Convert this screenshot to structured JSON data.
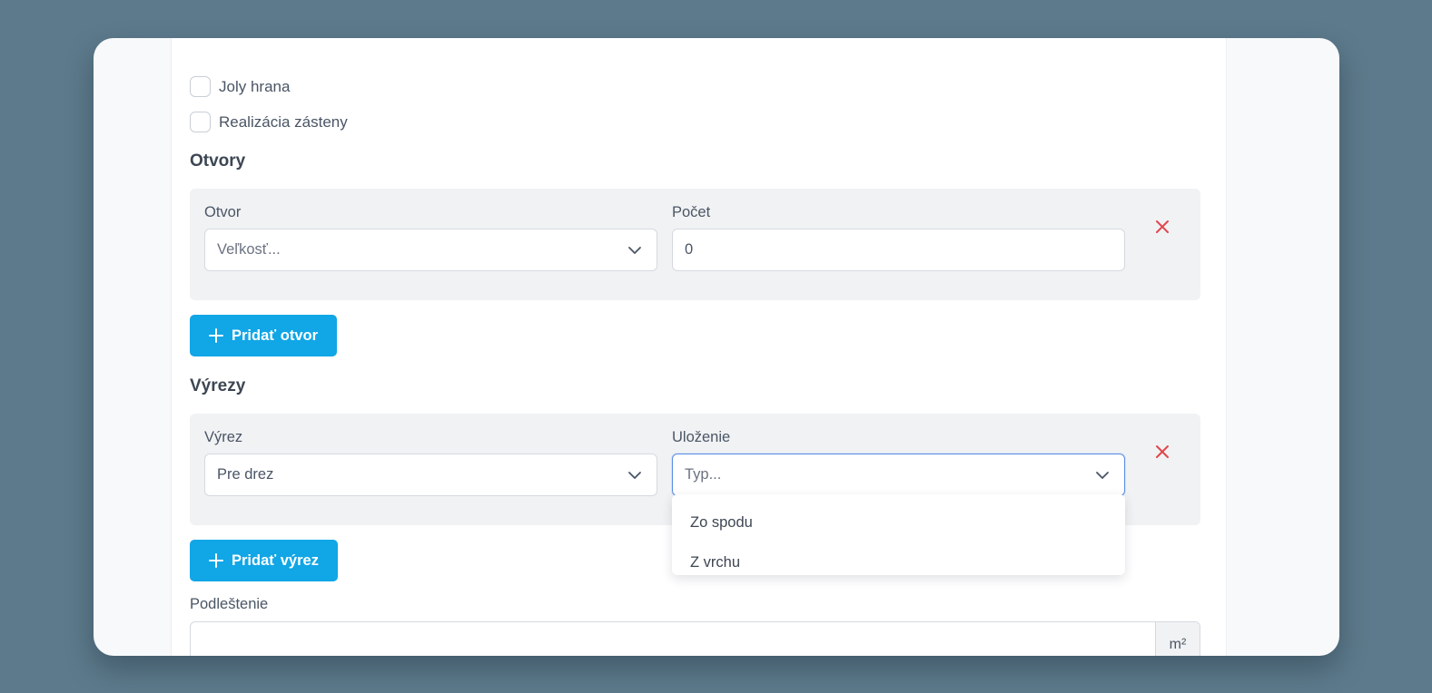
{
  "options": {
    "joly_hrana": {
      "label": "Joly hrana",
      "checked": false
    },
    "realizacia_zasteny": {
      "label": "Realizácia zásteny",
      "checked": false
    }
  },
  "otvory": {
    "title": "Otvory",
    "row": {
      "otvor_label": "Otvor",
      "otvor_placeholder": "Veľkosť...",
      "pocet_label": "Počet",
      "pocet_value": "0"
    },
    "add_button_label": "Pridať otvor"
  },
  "vyrezy": {
    "title": "Výrezy",
    "row": {
      "vyrez_label": "Výrez",
      "vyrez_value": "Pre drez",
      "ulozenie_label": "Uloženie",
      "ulozenie_placeholder": "Typ..."
    },
    "add_button_label": "Pridať výrez",
    "ulozenie_options": [
      "Zo spodu",
      "Z vrchu"
    ]
  },
  "podlestenie": {
    "label": "Podleštenie",
    "value": "",
    "unit": "m²"
  },
  "colors": {
    "accent": "#11a6e6",
    "danger": "#e0474c",
    "focus": "#5b8fe6"
  }
}
